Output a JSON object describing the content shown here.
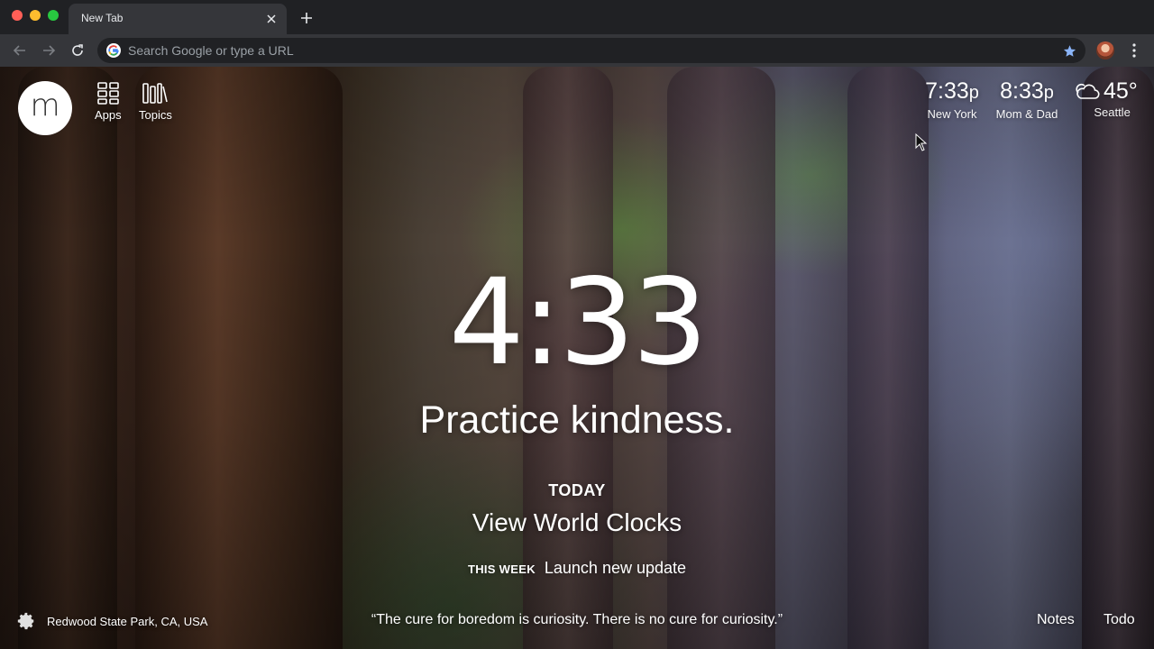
{
  "browser": {
    "tab_title": "New Tab",
    "omnibox_placeholder": "Search Google or type a URL"
  },
  "nav": {
    "apps_label": "Apps",
    "topics_label": "Topics",
    "logo_letter": "m"
  },
  "clocks": [
    {
      "time": "7:33",
      "ampm": "p",
      "label": "New York"
    },
    {
      "time": "8:33",
      "ampm": "p",
      "label": "Mom & Dad"
    }
  ],
  "weather": {
    "temp": "45°",
    "location": "Seattle",
    "icon": "cloudy-icon"
  },
  "main": {
    "time": "4:33",
    "mantra": "Practice kindness.",
    "today_label": "TODAY",
    "today_focus": "View World Clocks",
    "week_label": "THIS WEEK",
    "week_value": "Launch new update"
  },
  "footer": {
    "location": "Redwood State Park, CA, USA",
    "quote": "“The cure for boredom is curiosity. There is no cure for curiosity.”",
    "notes_label": "Notes",
    "todo_label": "Todo"
  },
  "colors": {
    "chrome_dark": "#202124",
    "chrome_toolbar": "#35363a",
    "star_accent": "#8ab4f8"
  }
}
